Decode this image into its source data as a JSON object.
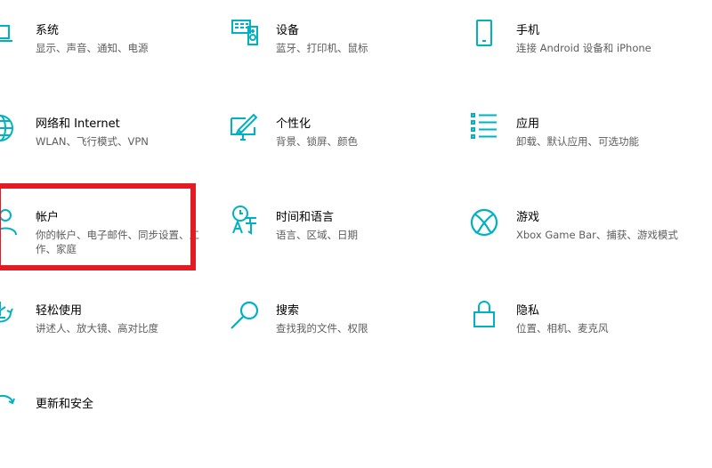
{
  "accent_color": "#00b2c1",
  "highlight_color": "#e31b23",
  "tiles": [
    {
      "title": "系统",
      "desc": "显示、声音、通知、电源",
      "icon": "laptop-icon"
    },
    {
      "title": "设备",
      "desc": "蓝牙、打印机、鼠标",
      "icon": "devices-icon"
    },
    {
      "title": "手机",
      "desc": "连接 Android 设备和 iPhone",
      "icon": "phone-icon"
    },
    {
      "title": "网络和 Internet",
      "desc": "WLAN、飞行模式、VPN",
      "icon": "globe-icon"
    },
    {
      "title": "个性化",
      "desc": "背景、锁屏、颜色",
      "icon": "personalization-icon"
    },
    {
      "title": "应用",
      "desc": "卸载、默认应用、可选功能",
      "icon": "apps-list-icon"
    },
    {
      "title": "帐户",
      "desc": "你的帐户、电子邮件、同步设置、工作、家庭",
      "icon": "person-icon"
    },
    {
      "title": "时间和语言",
      "desc": "语言、区域、日期",
      "icon": "time-language-icon"
    },
    {
      "title": "游戏",
      "desc": "Xbox Game Bar、捕获、游戏模式",
      "icon": "xbox-icon"
    },
    {
      "title": "轻松使用",
      "desc": "讲述人、放大镜、高对比度",
      "icon": "ease-of-access-icon"
    },
    {
      "title": "搜索",
      "desc": "查找我的文件、权限",
      "icon": "search-icon"
    },
    {
      "title": "隐私",
      "desc": "位置、相机、麦克风",
      "icon": "lock-icon"
    },
    {
      "title": "更新和安全",
      "desc": "",
      "icon": "update-icon"
    }
  ]
}
